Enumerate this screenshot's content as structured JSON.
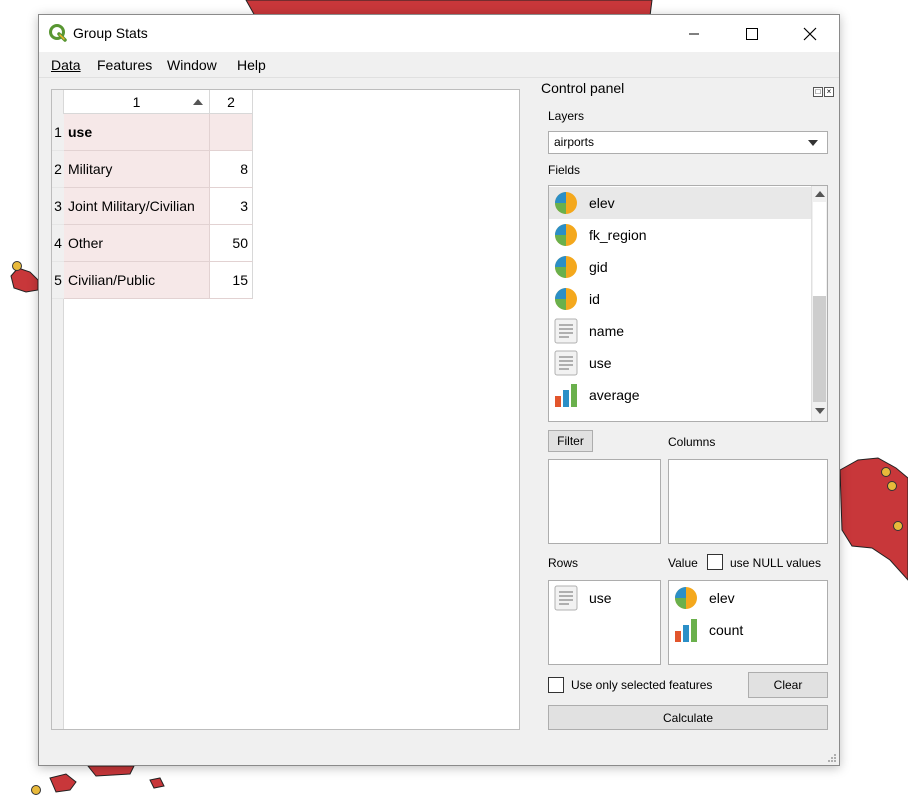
{
  "window": {
    "title": "Group Stats"
  },
  "menu": {
    "data": "Data",
    "features": "Features",
    "window": "Window",
    "help": "Help"
  },
  "table": {
    "col_headers": [
      "1",
      "2"
    ],
    "row_numbers": [
      "1",
      "2",
      "3",
      "4",
      "5"
    ],
    "rows": [
      {
        "label": "use",
        "value": ""
      },
      {
        "label": "Military",
        "value": "8"
      },
      {
        "label": "Joint Military/Civilian",
        "value": "3"
      },
      {
        "label": "Other",
        "value": "50"
      },
      {
        "label": "Civilian/Public",
        "value": "15"
      }
    ]
  },
  "control_panel": {
    "title": "Control panel",
    "layers_label": "Layers",
    "layer_selected": "airports",
    "fields_label": "Fields",
    "fields": [
      {
        "name": "elev",
        "icon": "numeric-field-icon"
      },
      {
        "name": "fk_region",
        "icon": "numeric-field-icon"
      },
      {
        "name": "gid",
        "icon": "numeric-field-icon"
      },
      {
        "name": "id",
        "icon": "numeric-field-icon"
      },
      {
        "name": "name",
        "icon": "text-field-icon"
      },
      {
        "name": "use",
        "icon": "text-field-icon"
      },
      {
        "name": "average",
        "icon": "calculation-icon"
      }
    ],
    "filter_button": "Filter",
    "columns_label": "Columns",
    "rows_label": "Rows",
    "value_label": "Value",
    "use_null_label": "use NULL values",
    "rows_items": [
      {
        "name": "use",
        "icon": "text-field-icon"
      }
    ],
    "value_items": [
      {
        "name": "elev",
        "icon": "numeric-field-icon"
      },
      {
        "name": "count",
        "icon": "calculation-icon"
      }
    ],
    "selected_features_label": "Use only selected features",
    "clear_button": "Clear",
    "calculate_button": "Calculate"
  },
  "colors": {
    "map_feature": "#c8373a",
    "airport_dot": "#e8b93a",
    "row_header_fill": "#f6e8e8"
  }
}
